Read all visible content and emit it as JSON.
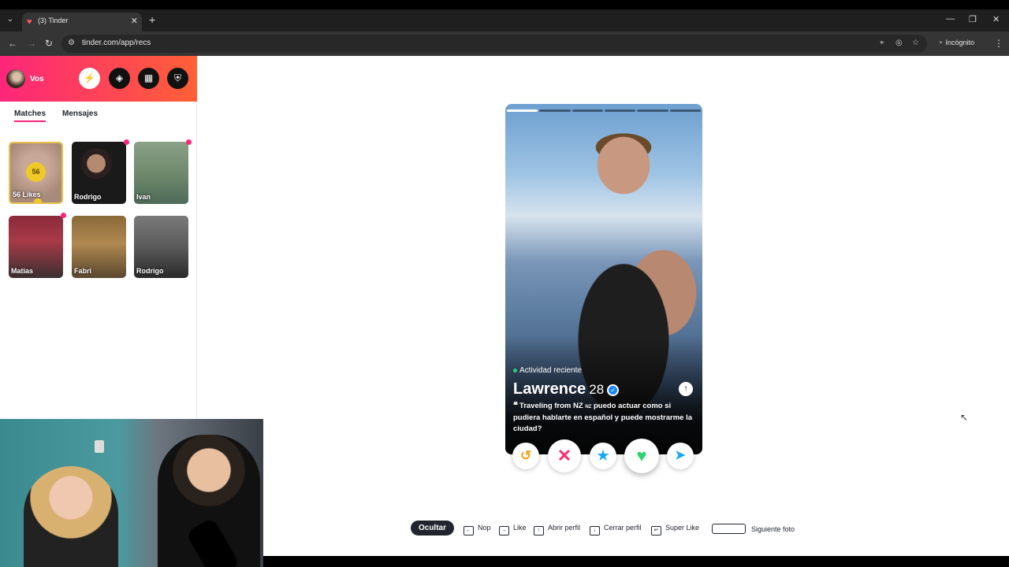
{
  "browser": {
    "tab_title": "(3) Tinder",
    "url": "tinder.com/app/recs",
    "incognito_label": "Incógnito",
    "icons": [
      "tab-list-icon",
      "tinder-favicon",
      "close-icon",
      "plus-icon",
      "minimize-icon",
      "restore-icon",
      "close-window-icon",
      "back-icon",
      "forward-icon",
      "reload-icon",
      "site-info-icon",
      "location-icon",
      "eye-off-icon",
      "star-icon",
      "incognito-icon",
      "kebab-icon"
    ]
  },
  "sidebar": {
    "user_label": "Vos",
    "header_buttons": [
      "boost-icon",
      "explore-icon",
      "briefcase-icon",
      "shield-icon"
    ],
    "tabs": [
      {
        "label": "Matches",
        "active": true
      },
      {
        "label": "Mensajes",
        "active": false
      }
    ],
    "likes": {
      "count": "56",
      "label": "56 Likes"
    },
    "matches": [
      {
        "name": "Rodrigo",
        "unread": true
      },
      {
        "name": "Ivan",
        "unread": true
      },
      {
        "name": "Matias",
        "unread": true
      },
      {
        "name": "Fabri",
        "unread": false
      },
      {
        "name": "Rodrigo",
        "unread": false
      }
    ]
  },
  "card": {
    "activity": "Actividad reciente",
    "name": "Lawrence",
    "age": "28",
    "verified": true,
    "photo_count": 6,
    "active_photo": 1,
    "bio_prefix": "Traveling from NZ",
    "bio_flag": "NZ",
    "bio_suffix": "puedo actuar como si pudiera hablarte en español y puede mostrarme la ciudad?"
  },
  "actions": [
    "rewind-icon",
    "nope-icon",
    "super-like-icon",
    "like-icon",
    "boost-icon"
  ],
  "hints": {
    "hide": "Ocultar",
    "nope": "Nop",
    "like": "Like",
    "open_profile": "Abrir perfil",
    "close_profile": "Cerrar perfil",
    "super_like": "Super Like",
    "next_photo": "Siguiente foto"
  },
  "colors": {
    "brand_gradient_start": "#fd267a",
    "brand_gradient_end": "#ff6036",
    "likes_gold": "#f0c929",
    "like_green": "#30d36e",
    "nope_red": "#ff2d6f",
    "super_blue": "#1aa8f2",
    "rewind_orange": "#f5a01b"
  }
}
